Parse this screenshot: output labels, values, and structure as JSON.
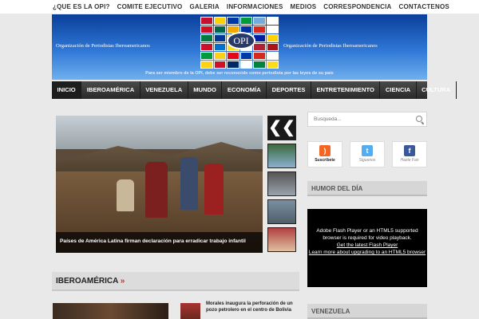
{
  "topnav": [
    "¿QUE ES LA OPI?",
    "COMITE EJECUTIVO",
    "GALERIA",
    "INFORMACIONES",
    "MEDIOS",
    "CORRESPONDENCIA",
    "CONTACTENOS"
  ],
  "banner": {
    "org_left": "Organización de Periodistas Iberoamericanos",
    "org_right": "Organización de Periodistas Iberoamericanos",
    "badge": "OPI",
    "member_text": "Para ser miembro de la OPI, debe ser reconocido  como periodista por las leyes de su país",
    "flag_colors": [
      "#c8102e",
      "#ffd100",
      "#0038a8",
      "#009c3b",
      "#75aadb",
      "#ffffff",
      "#ce1126",
      "#006847",
      "#f2a800",
      "#0033a0",
      "#d52b1e",
      "#ffffff",
      "#007a3d",
      "#003893",
      "#ffcc00",
      "#da291c",
      "#00209f",
      "#ffd100",
      "#ce1126",
      "#0072ce",
      "#f7e017",
      "#ffffff",
      "#b22234",
      "#aa151b",
      "#009b3a",
      "#fcd116",
      "#e30a17",
      "#0038a8",
      "#d52b1e",
      "#ffffff",
      "#fcd116",
      "#ce1126",
      "#002868",
      "#ffffff",
      "#00843d",
      "#f9dd16"
    ]
  },
  "mainnav": [
    "INICIO",
    "IBEROAMÉRICA",
    "VENEZUELA",
    "MUNDO",
    "ECONOMÍA",
    "DEPORTES",
    "ENTRETENIMIENTO",
    "CIENCIA",
    "CULTURA"
  ],
  "slider": {
    "caption": "Países de América Latina firman declaración para erradicar trabajo infantil",
    "prev_label": "❮❮"
  },
  "search": {
    "placeholder": "Busqueda..."
  },
  "social": [
    {
      "label": "Suscribete",
      "icon": "rss-icon",
      "glyph": ")",
      "color": "#f26522"
    },
    {
      "label": "Siguenos",
      "icon": "twitter-icon",
      "glyph": "t",
      "color": "#55acee"
    },
    {
      "label": "Hazte Fan",
      "icon": "facebook-icon",
      "glyph": "f",
      "color": "#3b5998"
    }
  ],
  "humor": {
    "title": "HUMOR DEL DÍA"
  },
  "flash": {
    "line1": "Adobe Flash Player or an HTML5 supported browser is required for video playback.",
    "link1": "Get the latest Flash Player",
    "link2": "Learn more about upgrading to an HTML5 browser"
  },
  "section": {
    "title": "IBEROAMÉRICA",
    "chevron": "»"
  },
  "news": {
    "headline": "Morales inaugura la perforación de un pozo petrolero en el centro de Bolivia"
  },
  "venezuela": {
    "title": "VENEZUELA"
  }
}
